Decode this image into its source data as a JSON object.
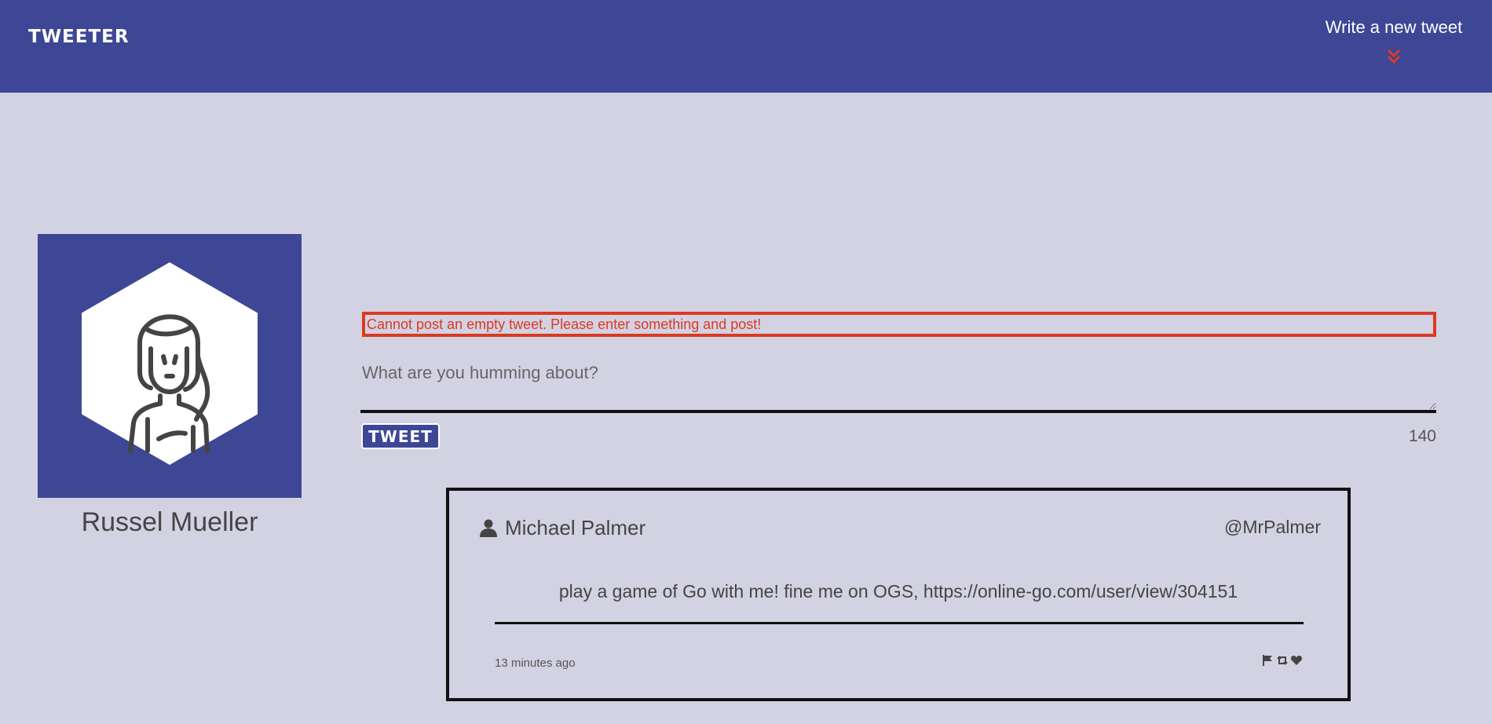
{
  "nav": {
    "brand": "TWEETER",
    "new_tweet_label": "Write a new tweet",
    "chevron_icon": "double-chevron-down-icon",
    "chevron_color": "#dc3a20",
    "background_color": "#3e4795"
  },
  "profile": {
    "name": "Russel Mueller",
    "avatar_icon": "avatar-woman-icon"
  },
  "compose": {
    "error_message": "Cannot post an empty tweet. Please enter something and post!",
    "placeholder": "What are you humming about?",
    "value": "",
    "button_label": "TWEET",
    "counter": "140"
  },
  "tweet": {
    "author": "Michael Palmer",
    "author_icon": "user-icon",
    "handle": "@MrPalmer",
    "content": "play a game of Go with me! fine me on OGS, https://online-go.com/user/view/304151",
    "timestamp": "13 minutes ago",
    "actions": [
      "flag-icon",
      "retweet-icon",
      "heart-icon"
    ]
  },
  "colors": {
    "page_background": "#d3d2e3",
    "accent": "#3e4795",
    "error": "#dc3a20"
  }
}
